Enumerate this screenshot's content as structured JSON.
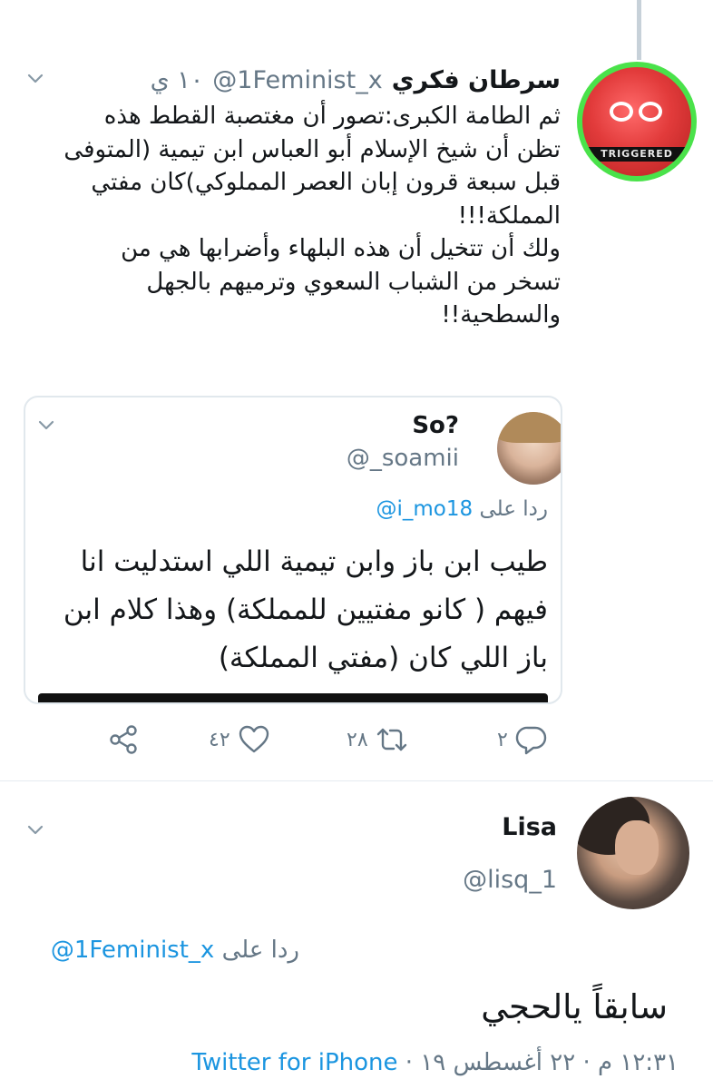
{
  "tweet1": {
    "name": "سرطان فكري",
    "handle": "@1Feminist_x",
    "time": "١٠ ي",
    "body": [
      "ثم الطامة الكبرى:تصور أن مغتصبة القطط هذه",
      "تظن أن شيخ الإسلام أبو العباس ابن تيمية (المتوفى",
      "قبل سبعة قرون إبان العصر المملوكي)كان مفتي",
      "المملكة!!!",
      "ولك أن تتخيل أن هذه البلهاء وأضرابها هي من",
      "تسخر من الشباب السعوي وترميهم بالجهل",
      "والسطحية!!"
    ],
    "avatar_caption": "TRIGGERED",
    "quote": {
      "name": "So?",
      "handle": "@_soamii",
      "reply_prefix": "ردا على",
      "reply_handle": "@i_mo18",
      "text": [
        "طيب ابن باز وابن تيمية اللي استدليت انا",
        "فيهم ( كانو مفتيين للمملكة) وهذا كلام ابن",
        "باز اللي كان (مفتي المملكة)"
      ]
    },
    "actions": {
      "replies": "٢",
      "retweets": "٢٨",
      "likes": "٤٢"
    }
  },
  "tweet2": {
    "name": "Lisa",
    "handle": "@lisq_1",
    "reply_prefix": "ردا على",
    "reply_handle": "@1Feminist_x",
    "text": "سابقاً يالحجي",
    "timestamp": "١٢:٣١ م · ٢٢ أغسطس ١٩",
    "separator": "·",
    "source": "Twitter for iPhone"
  },
  "colors": {
    "link": "#1b95e0",
    "secondary_text": "#657786",
    "avatar_ring": "#4ae24a"
  }
}
